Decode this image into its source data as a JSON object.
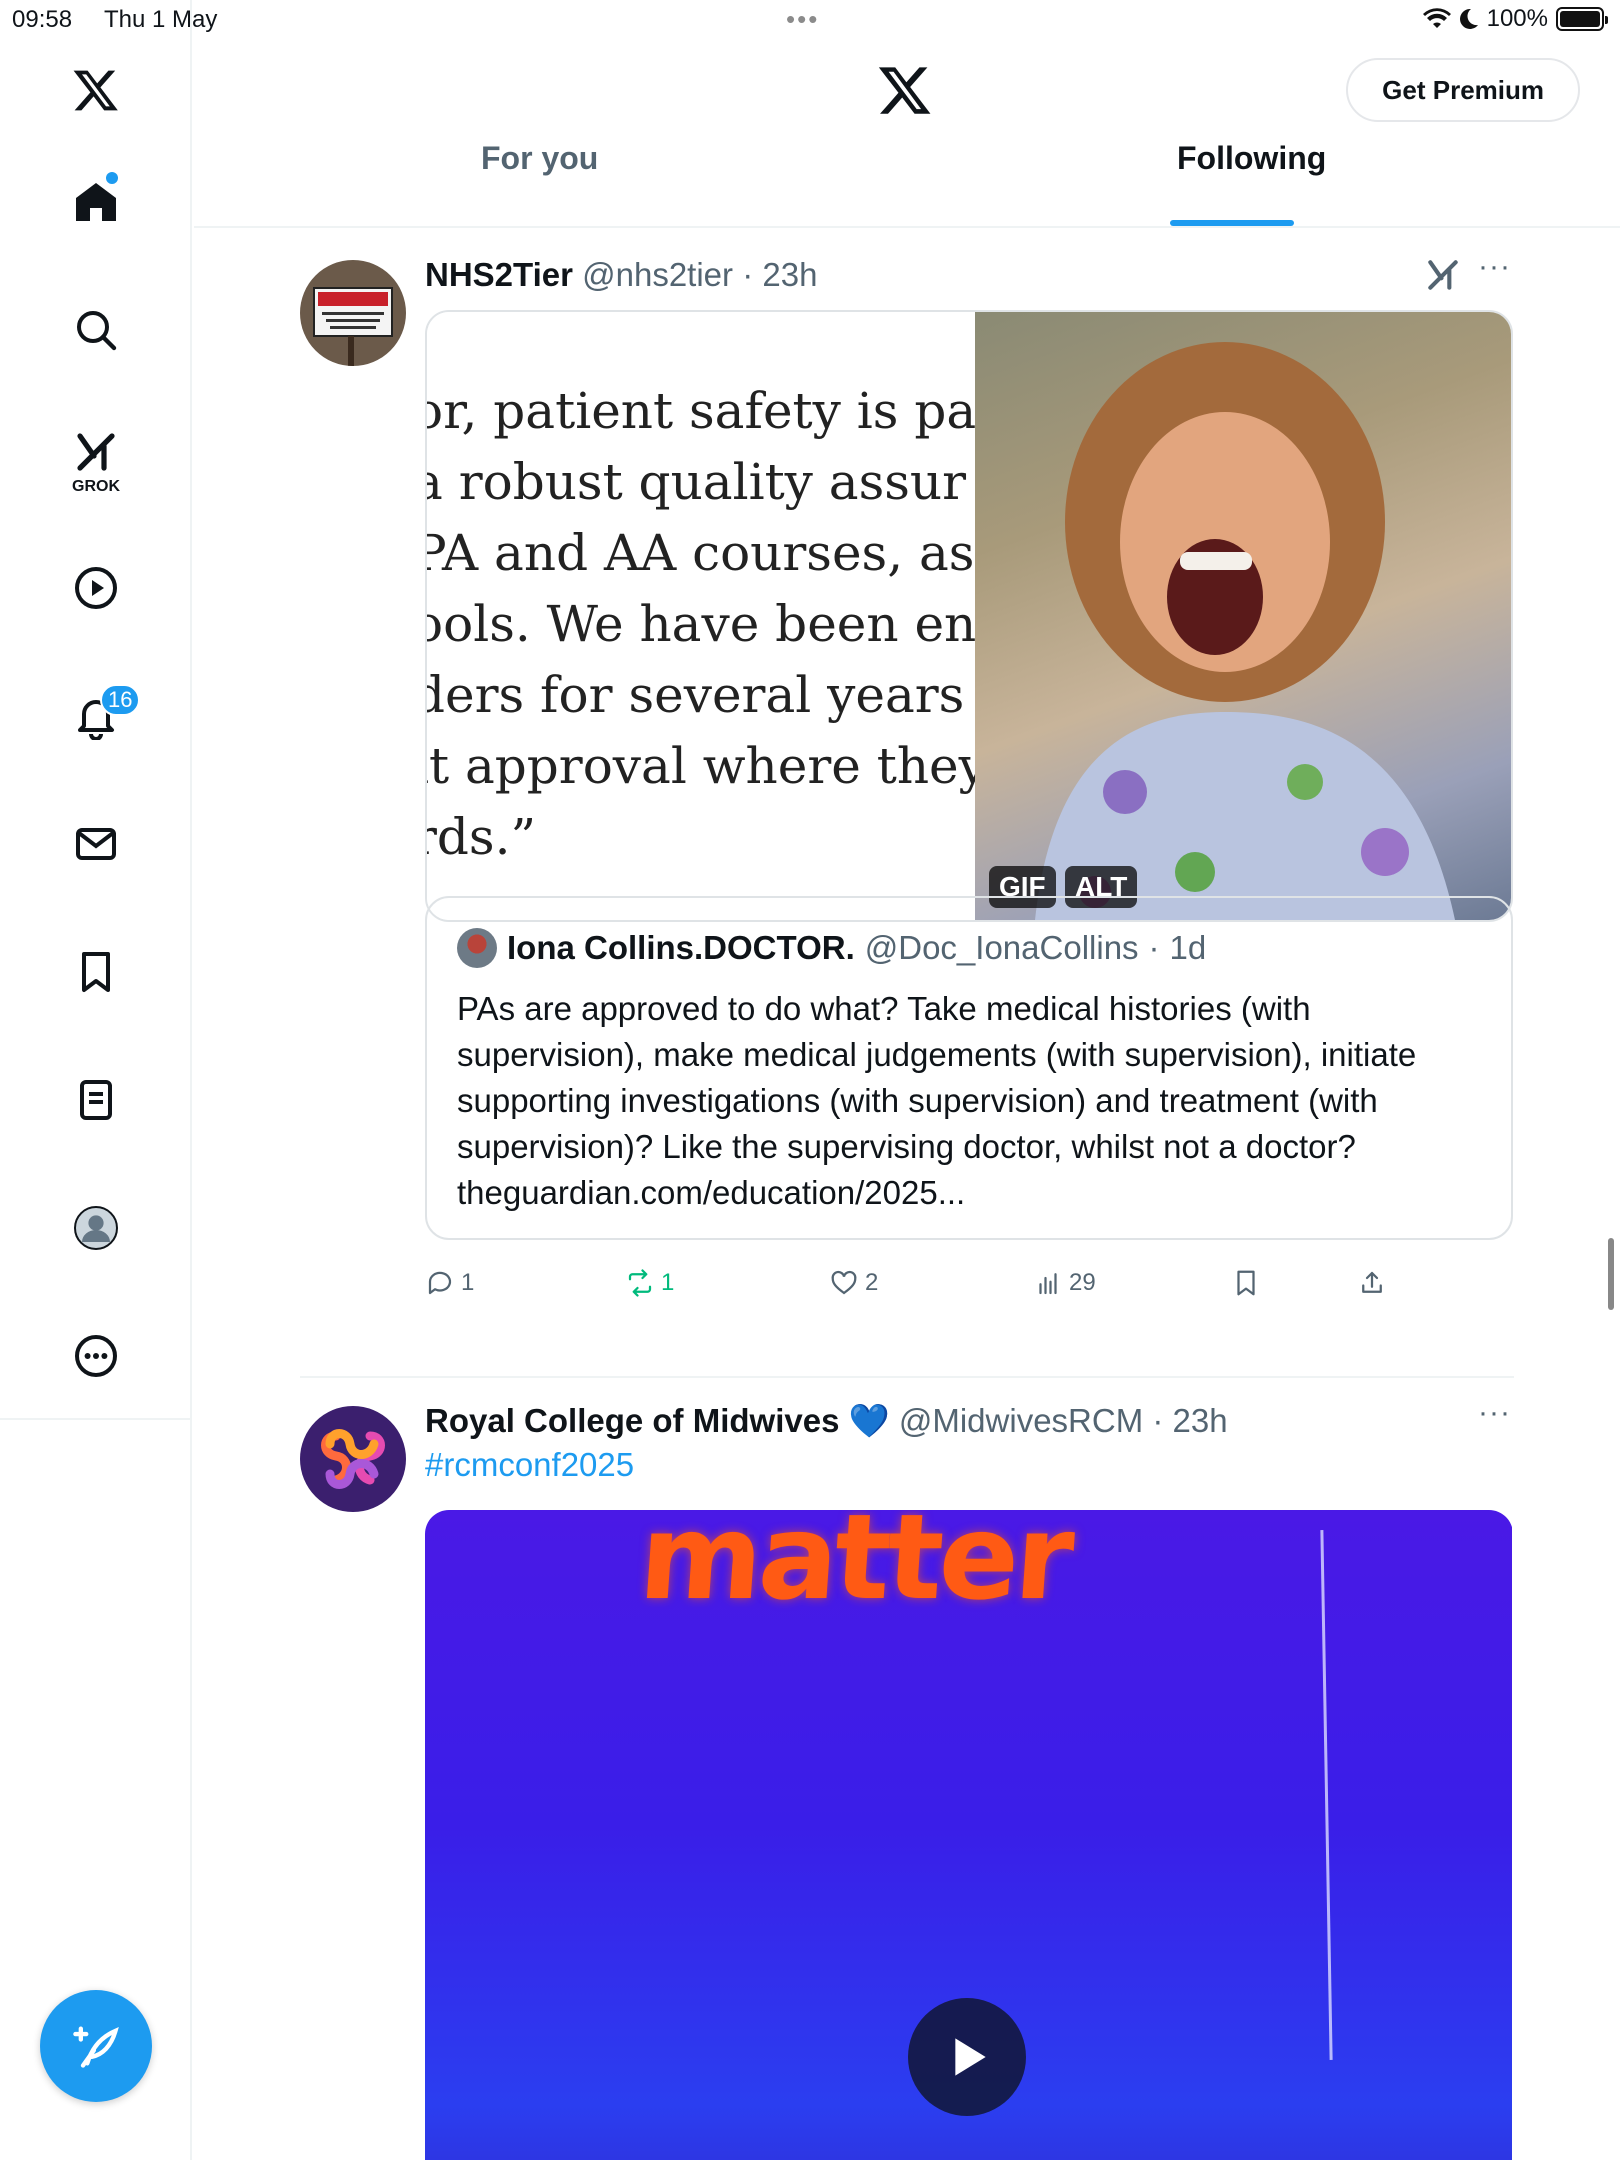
{
  "status_bar": {
    "time": "09:58",
    "date": "Thu 1 May",
    "dots": "•••",
    "battery": "100%"
  },
  "sidebar": {
    "grok_label": "GROK",
    "notifications_count": "16"
  },
  "header": {
    "premium_label": "Get Premium",
    "tabs": [
      {
        "label": "For you"
      },
      {
        "label": "Following"
      }
    ],
    "selected_tab": "Following"
  },
  "tweets": [
    {
      "name": "NHS2Tier",
      "handle": "@nhs2tier",
      "sep": "·",
      "time": "23h",
      "more": "···",
      "media": {
        "text_lines": [
          "or, patient safety is pa",
          " a robust quality assur",
          "PA and AA courses, as w",
          "ools. We have been eng",
          "ders for several years a",
          "it approval where they",
          "rds.”"
        ],
        "badge_gif": "GIF",
        "badge_alt": "ALT"
      },
      "quote": {
        "name": "Iona Collins.DOCTOR.",
        "handle": "@Doc_IonaCollins",
        "sep": "·",
        "time": "1d",
        "body": "PAs are approved to do what? Take medical histories (with supervision), make medical judgements (with supervision), initiate supporting investigations (with supervision) and treatment (with supervision)? Like the supervising doctor, whilst not a doctor? theguardian.com/education/2025..."
      },
      "actions": {
        "replies": "1",
        "reposts": "1",
        "likes": "2",
        "views": "29"
      },
      "colors": {
        "repost_active": "#00ba7c"
      }
    },
    {
      "name": "Royal College of Midwives",
      "verified": "💙",
      "handle": "@MidwivesRCM",
      "sep": "·",
      "time": "23h",
      "more": "···",
      "hashtag": "#rcmconf2025",
      "video_word": "matter"
    }
  ],
  "colors": {
    "accent": "#1d9bf0",
    "text": "#0f1419",
    "muted": "#536471"
  }
}
